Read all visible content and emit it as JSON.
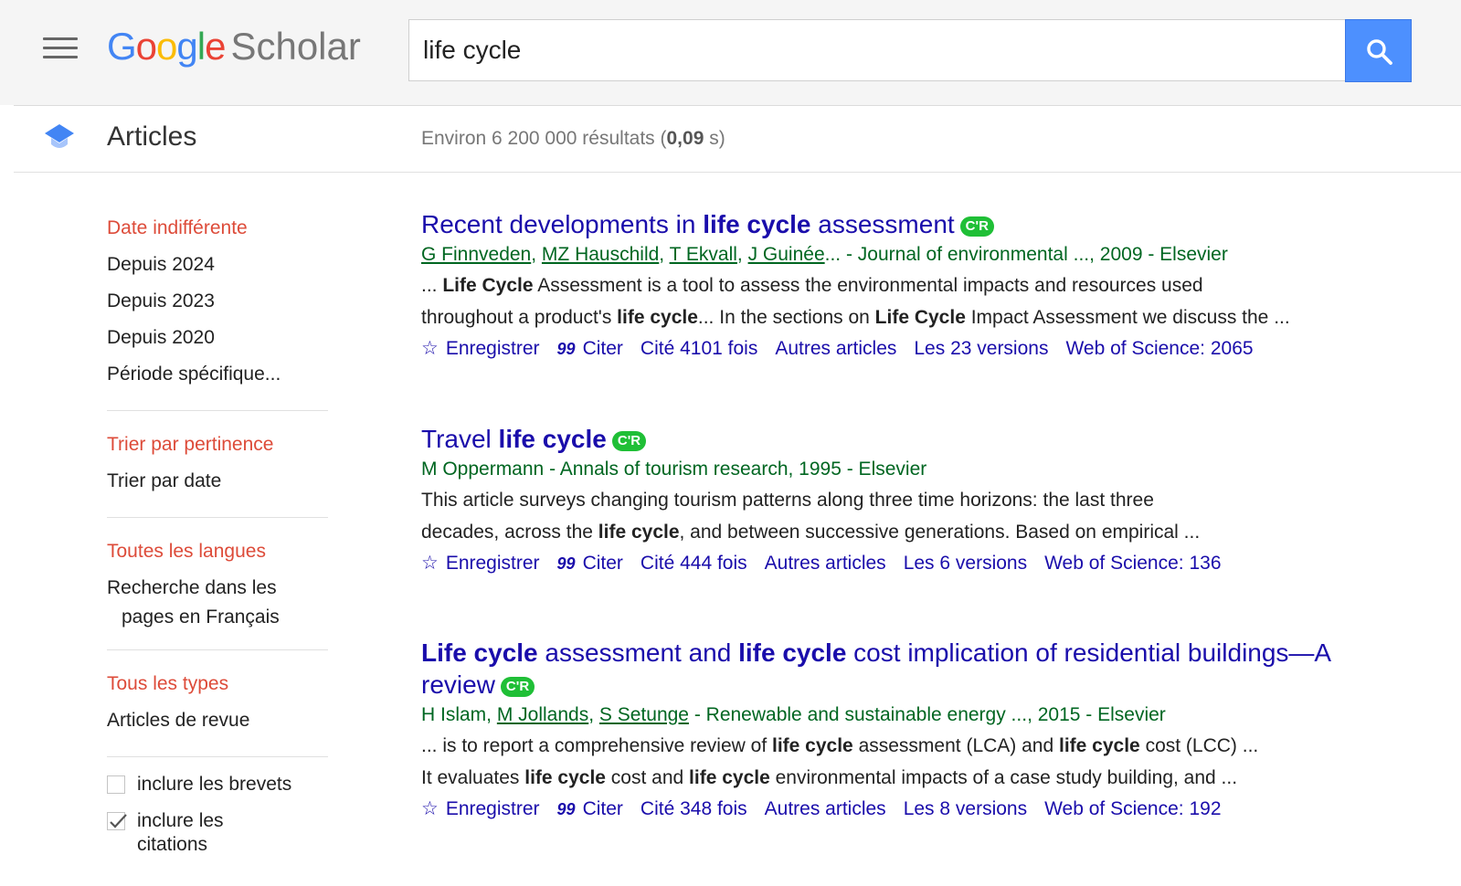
{
  "header": {
    "logo_google": [
      "G",
      "o",
      "o",
      "g",
      "l",
      "e"
    ],
    "logo_scholar": "Scholar",
    "search_value": "life cycle"
  },
  "subheader": {
    "section": "Articles",
    "results_prefix": "Environ 6 200 000 résultats (",
    "results_time": "0,09",
    "results_suffix": " s)"
  },
  "sidebar": {
    "date": [
      "Date indifférente",
      "Depuis 2024",
      "Depuis 2023",
      "Depuis 2020",
      "Période spécifique..."
    ],
    "sort": [
      "Trier par pertinence",
      "Trier par date"
    ],
    "lang": [
      "Toutes les langues",
      "Recherche dans les",
      "pages en Français"
    ],
    "types": [
      "Tous les types",
      "Articles de revue"
    ],
    "checks": [
      {
        "label": "inclure les brevets",
        "checked": false
      },
      {
        "label": "inclure les citations",
        "checked": true
      }
    ]
  },
  "badge": "C'R",
  "results": [
    {
      "title_parts": [
        [
          "Recent developments in ",
          false
        ],
        [
          "life cycle",
          true
        ],
        [
          " assessment",
          false
        ]
      ],
      "authors": [
        "G Finnveden",
        "MZ Hauschild",
        "T Ekvall",
        "J Guinée"
      ],
      "source": "... - Journal of environmental ..., 2009 - Elsevier",
      "snippet1": [
        [
          "... ",
          false
        ],
        [
          "Life Cycle",
          true
        ],
        [
          " Assessment is a tool to assess the environmental impacts and resources used",
          false
        ]
      ],
      "snippet2": [
        [
          "throughout a product's ",
          false
        ],
        [
          "life cycle",
          true
        ],
        [
          "... In the sections on ",
          false
        ],
        [
          "Life Cycle",
          true
        ],
        [
          " Impact Assessment we discuss the ...",
          false
        ]
      ],
      "actions": [
        "Enregistrer",
        "Citer",
        "Cité 4101 fois",
        "Autres articles",
        "Les 23 versions",
        "Web of Science: 2065"
      ]
    },
    {
      "title_parts": [
        [
          "Travel ",
          false
        ],
        [
          "life cycle",
          true
        ]
      ],
      "authors_plain": "M Oppermann",
      "source": " - Annals of tourism research, 1995 - Elsevier",
      "snippet1": [
        [
          "This article surveys changing tourism patterns along three time horizons: the last three",
          false
        ]
      ],
      "snippet2": [
        [
          "decades, across the ",
          false
        ],
        [
          "life cycle",
          true
        ],
        [
          ", and between successive generations. Based on empirical ...",
          false
        ]
      ],
      "actions": [
        "Enregistrer",
        "Citer",
        "Cité 444 fois",
        "Autres articles",
        "Les 6 versions",
        "Web of Science: 136"
      ]
    },
    {
      "title_parts": [
        [
          "Life cycle",
          true
        ],
        [
          " assessment and ",
          false
        ],
        [
          "life cycle",
          true
        ],
        [
          " cost implication of residential buildings—A",
          false
        ]
      ],
      "title_line2": "review",
      "authors_plain": "H Islam, ",
      "authors": [
        "M Jollands",
        "S Setunge"
      ],
      "source": " - Renewable and sustainable energy ..., 2015 - Elsevier",
      "snippet1": [
        [
          "... is to report a comprehensive review of ",
          false
        ],
        [
          "life cycle",
          true
        ],
        [
          " assessment (LCA) and ",
          false
        ],
        [
          "life cycle",
          true
        ],
        [
          " cost (LCC) ...",
          false
        ]
      ],
      "snippet2": [
        [
          "It evaluates ",
          false
        ],
        [
          "life cycle",
          true
        ],
        [
          " cost and ",
          false
        ],
        [
          "life cycle",
          true
        ],
        [
          " environmental impacts of a case study building, and ...",
          false
        ]
      ],
      "actions": [
        "Enregistrer",
        "Citer",
        "Cité 348 fois",
        "Autres articles",
        "Les 8 versions",
        "Web of Science: 192"
      ]
    }
  ]
}
